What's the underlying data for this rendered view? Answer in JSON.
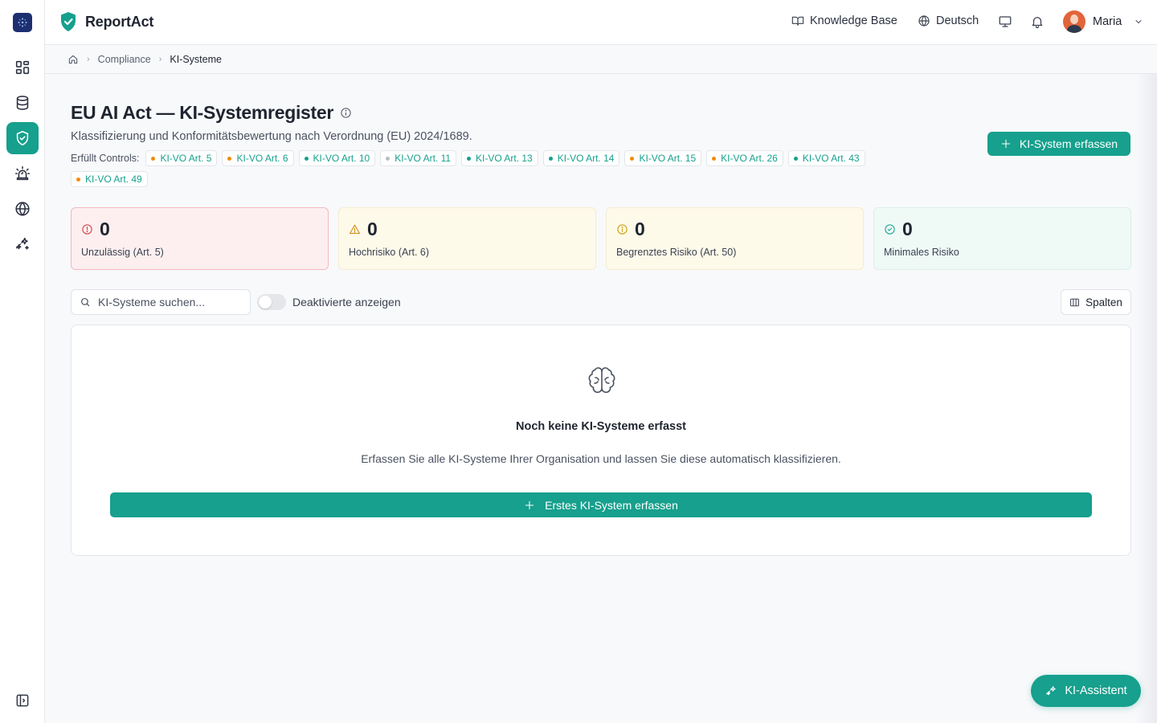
{
  "colors": {
    "accent": "#16a08d",
    "danger": "#d63a3a",
    "warning": "#d08a12",
    "limited": "#c99a00",
    "ok": "#16a08d",
    "chip_orange": "#f08c00",
    "chip_green": "#16a08d",
    "chip_gray": "#b8bcc4"
  },
  "rail": {
    "items": [
      {
        "name": "dashboard-icon",
        "active": false
      },
      {
        "name": "database-icon",
        "active": false
      },
      {
        "name": "shield-check-icon",
        "active": true
      },
      {
        "name": "siren-icon",
        "active": false
      },
      {
        "name": "globe-icon",
        "active": false
      },
      {
        "name": "sparkles-icon",
        "active": false
      }
    ],
    "collapse_icon": "sidebar-toggle-icon"
  },
  "header": {
    "brand": "ReportAct",
    "knowledge_base": "Knowledge Base",
    "language": "Deutsch",
    "user_name": "Maria"
  },
  "breadcrumb": {
    "items": [
      "Compliance",
      "KI-Systeme"
    ]
  },
  "page": {
    "title": "EU AI Act — KI-Systemregister",
    "subtitle": "Klassifizierung und Konformitätsbewertung nach Verordnung (EU) 2024/1689.",
    "controls_label": "Erfüllt Controls:",
    "controls": [
      {
        "label": "KI-VO Art. 5",
        "status": "orange"
      },
      {
        "label": "KI-VO Art. 6",
        "status": "orange"
      },
      {
        "label": "KI-VO Art. 10",
        "status": "green"
      },
      {
        "label": "KI-VO Art. 11",
        "status": "gray"
      },
      {
        "label": "KI-VO Art. 13",
        "status": "green"
      },
      {
        "label": "KI-VO Art. 14",
        "status": "green"
      },
      {
        "label": "KI-VO Art. 15",
        "status": "orange"
      },
      {
        "label": "KI-VO Art. 26",
        "status": "orange"
      },
      {
        "label": "KI-VO Art. 43",
        "status": "green"
      },
      {
        "label": "KI-VO Art. 49",
        "status": "orange"
      }
    ],
    "add_button": "KI-System erfassen"
  },
  "stats": [
    {
      "value": "0",
      "label": "Unzulässig (Art. 5)",
      "icon": "alert-circle-icon",
      "kind": "danger"
    },
    {
      "value": "0",
      "label": "Hochrisiko (Art. 6)",
      "icon": "alert-triangle-icon",
      "kind": "warning"
    },
    {
      "value": "0",
      "label": "Begrenztes Risiko (Art. 50)",
      "icon": "info-circle-icon",
      "kind": "limited"
    },
    {
      "value": "0",
      "label": "Minimales Risiko",
      "icon": "check-circle-icon",
      "kind": "ok"
    }
  ],
  "toolbar": {
    "search_placeholder": "KI-Systeme suchen...",
    "toggle_label": "Deaktivierte anzeigen",
    "columns_button": "Spalten"
  },
  "empty": {
    "title": "Noch keine KI-Systeme erfasst",
    "text": "Erfassen Sie alle KI-Systeme Ihrer Organisation und lassen Sie diese automatisch klassifizieren.",
    "button": "Erstes KI-System erfassen"
  },
  "assistant": {
    "label": "KI-Assistent"
  }
}
